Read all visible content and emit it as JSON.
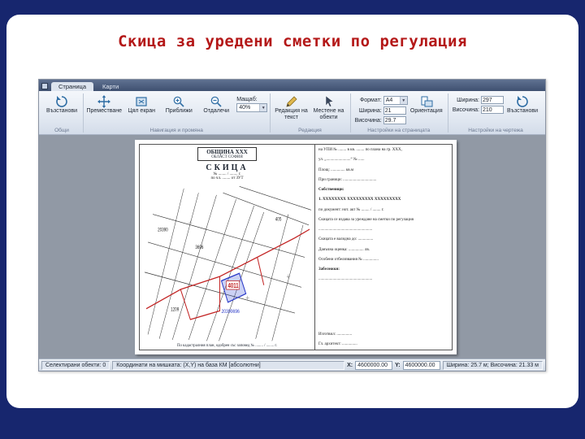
{
  "slide": {
    "title": "Скица за уредени сметки по регулация"
  },
  "app": {
    "tabs": [
      {
        "label": "Страница"
      },
      {
        "label": "Карти"
      }
    ],
    "ribbon": {
      "groups": [
        {
          "caption": "Общи",
          "buttons": [
            {
              "label": "Възстанови"
            }
          ]
        },
        {
          "caption": "Навигация и промяна",
          "buttons": [
            {
              "label": "Преместване"
            },
            {
              "label": "Цял екран"
            },
            {
              "label": "Приближи"
            },
            {
              "label": "Отдалечи"
            }
          ],
          "scale_label": "Мащаб:",
          "scale_value": "40%"
        },
        {
          "caption": "Редакция",
          "buttons": [
            {
              "label": "Редакция на текст"
            },
            {
              "label": "Местене на обекти"
            }
          ]
        },
        {
          "caption": "Настройки на страницата",
          "fields": [
            {
              "label": "Формат:",
              "value": "A4"
            },
            {
              "label": "Ширина:",
              "value": "21"
            },
            {
              "label": "Височина:",
              "value": "29.7"
            }
          ],
          "orientation_label": "Ориентация"
        },
        {
          "caption": "Настройки на чертежа",
          "fields": [
            {
              "label": "Ширина:",
              "value": "297"
            },
            {
              "label": "Височина:",
              "value": "210"
            }
          ],
          "restore_label": "Възстанови"
        }
      ]
    },
    "document": {
      "header_line1": "ОБЩИНА ХХХ",
      "header_line2": "ОБЛАСТ СОФИЯ",
      "title": "СКИЦА",
      "sub_line1": "№ ........ / ........ г.",
      "sub_line2": "по чл. ........ от ЗУТ",
      "map_labels": {
        "parcel": "4011",
        "parcel_id": "20390696",
        "n1": "20390",
        "n2": "3696",
        "n3": "405",
        "n4": "1209"
      },
      "footer": "По кадастралния план, одобрен със заповед № ........ / ........ г.",
      "right_lines": [
        "на УПИ № ........ в кв. ........ по плана на гр. ХХХ,",
        "ул. „........................“ № ......",
        "Площ: .............. кв.м",
        "При граници: .................................",
        "Собственици:",
        "1. ХХХХХХХХ ХХХХХХХХХ ХХХХХХХХХ",
        "по документ: нот. акт № ........ / ........ г.",
        "Скицата се издава за уреждане на сметки по регулация",
        ".....................................................",
        "Скицата е валидна до: ...............",
        "Данъчна оценка: ............... лв.",
        "Особени отбелязвания № ...............",
        "Забележки:",
        ".....................................................",
        "Изготвил: ...............",
        "Гл. архитект: ..............."
      ]
    },
    "statusbar": {
      "selected": "Селектирани обекти: 0",
      "coords": "Координати на мишката: (X,Y) на база КМ [абсолютни]",
      "x_label": "X:",
      "x_value": "4600000.00",
      "y_label": "Y:",
      "y_value": "4600000.00",
      "size": "Ширина: 25.7 м; Височина: 21.33 м"
    }
  }
}
